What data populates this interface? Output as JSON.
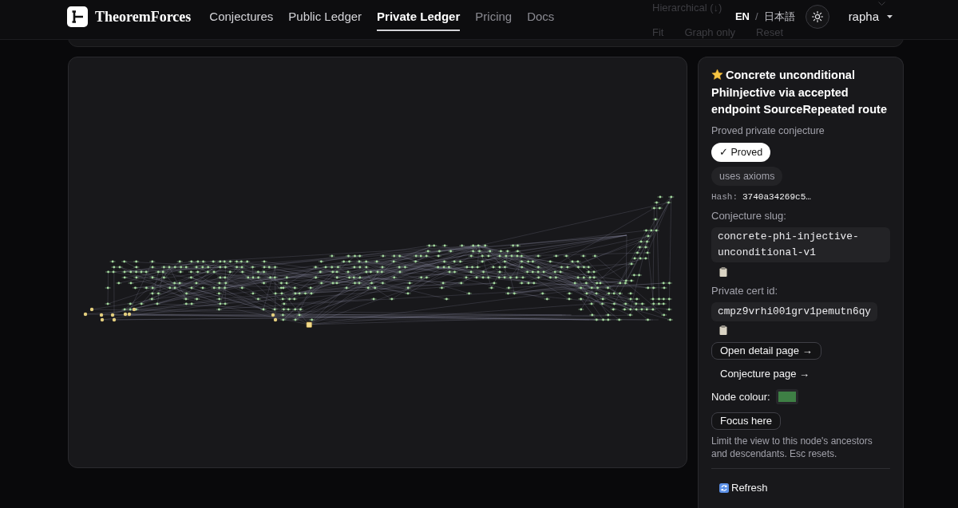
{
  "header": {
    "brand": "TheoremForces",
    "nav": [
      {
        "label": "Conjectures",
        "selected": false,
        "dim": false
      },
      {
        "label": "Public Ledger",
        "selected": false,
        "dim": false
      },
      {
        "label": "Private Ledger",
        "selected": true,
        "dim": false
      },
      {
        "label": "Pricing",
        "selected": false,
        "dim": true
      },
      {
        "label": "Docs",
        "selected": false,
        "dim": true
      }
    ],
    "languages": [
      {
        "label": "EN",
        "selected": true
      },
      {
        "label": "日本語",
        "selected": false
      }
    ],
    "language_separator": "/",
    "user": "rapha"
  },
  "toolbar": {
    "layout_select": "Hierarchical (↓)",
    "buttons": [
      "Fit",
      "Graph only",
      "Reset"
    ]
  },
  "detail": {
    "starred": true,
    "title": "Concrete unconditional PhiInjective via accepted endpoint SourceRepeated route",
    "subtitle": "Proved private conjecture",
    "badges": [
      {
        "label": "✓ Proved",
        "kind": "status"
      },
      {
        "label": "uses axioms",
        "kind": "tag"
      }
    ],
    "hash_label": "Hash:",
    "hash": "3740a34269c5…",
    "fields": [
      {
        "label": "Conjecture slug:",
        "value": "concrete-phi-injective-unconditional-v1"
      },
      {
        "label": "Private cert id:",
        "value": "cmpz9vrhi001grv1pemutn6qy"
      }
    ],
    "actions": [
      {
        "label": "Open detail page →",
        "kind": "outlined"
      },
      {
        "label": "Conjecture page →",
        "kind": "plain"
      }
    ],
    "node_colour": {
      "label": "Node colour:",
      "color": "#3e7f45"
    },
    "focus_button": "Focus here",
    "focus_help": "Limit the view to this node's ancestors and descendants. Esc resets.",
    "refresh": "Refresh"
  }
}
